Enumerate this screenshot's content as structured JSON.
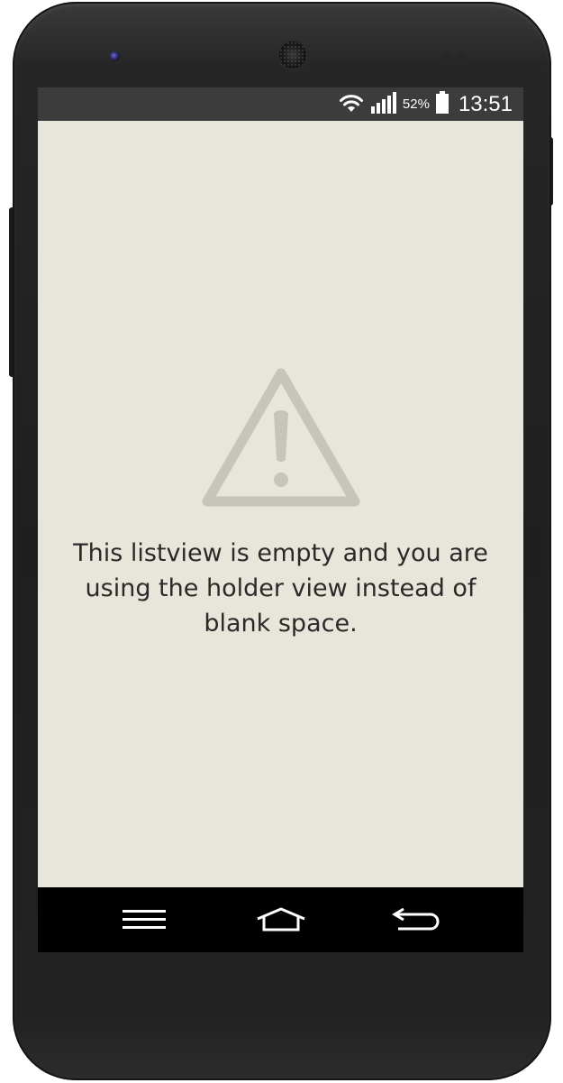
{
  "status_bar": {
    "battery_percent": "52%",
    "time": "13:51",
    "icons": [
      "wifi-icon",
      "signal-icon",
      "battery-icon"
    ],
    "background_color": "#3c3c3c"
  },
  "content": {
    "icon": "warning-icon",
    "message": "This listview is empty and you are using the holder view instead of blank space.",
    "background_color": "#e8e5da",
    "icon_color": "#c7c4bc"
  },
  "nav_bar": {
    "buttons": [
      "menu-icon",
      "home-icon",
      "back-icon"
    ],
    "background_color": "#000000"
  }
}
